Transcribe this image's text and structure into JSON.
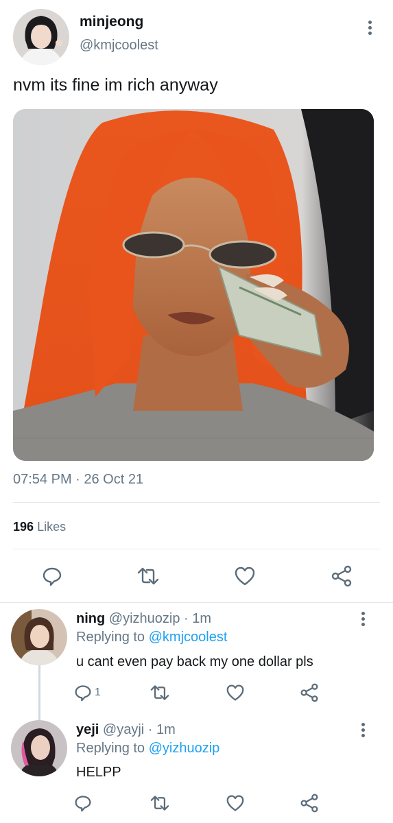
{
  "tweet": {
    "display_name": "minjeong",
    "handle": "@kmjcoolest",
    "text": "nvm its fine im rich anyway",
    "timestamp": "07:54 PM · 26 Oct 21",
    "likes_count": "196",
    "likes_label": "Likes"
  },
  "replies": [
    {
      "display_name": "ning",
      "handle": "@yizhuozip",
      "time": "· 1m",
      "replying_label": "Replying to",
      "replying_to": "@kmjcoolest",
      "text": "u cant even pay back my one dollar pls",
      "reply_count": "1"
    },
    {
      "display_name": "yeji",
      "handle": "@yayji",
      "time": "· 1m",
      "replying_label": "Replying to",
      "replying_to": "@yizhuozip",
      "text": "HELPP",
      "reply_count": ""
    }
  ],
  "icons": {
    "reply": "reply-icon",
    "retweet": "retweet-icon",
    "like": "heart-icon",
    "share": "share-icon",
    "more": "more-vertical-icon"
  },
  "colors": {
    "text_primary": "#14171a",
    "text_secondary": "#657786",
    "link": "#1da1f2",
    "icon": "#5b6b78"
  }
}
